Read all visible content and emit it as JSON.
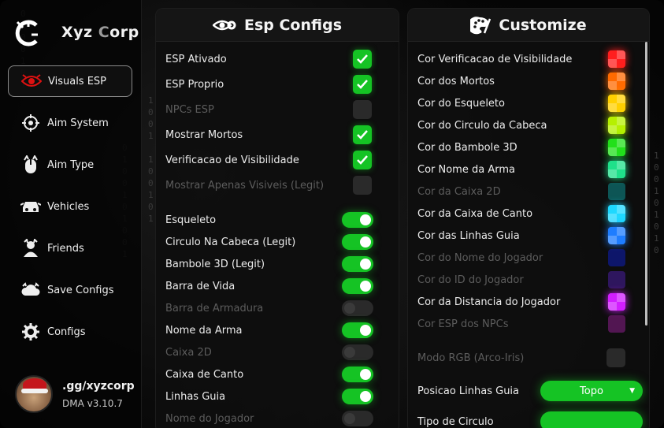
{
  "brand": {
    "name_main": "Xyz",
    "name_accent": "C",
    "name_rest": "orp"
  },
  "nav": [
    {
      "label": "Visuals ESP",
      "icon": "eye-icon",
      "active": true
    },
    {
      "label": "Aim System",
      "icon": "crosshair-icon",
      "active": false
    },
    {
      "label": "Aim Type",
      "icon": "mouse-icon",
      "active": false
    },
    {
      "label": "Vehicles",
      "icon": "car-icon",
      "active": false
    },
    {
      "label": "Friends",
      "icon": "users-icon",
      "active": false
    },
    {
      "label": "Save Configs",
      "icon": "cloud-icon",
      "active": false
    },
    {
      "label": "Configs",
      "icon": "gear-icon",
      "active": false
    }
  ],
  "user": {
    "name": ".gg/xyzcorp",
    "version": "DMA v3.10.7"
  },
  "esp": {
    "title": "Esp Configs",
    "checkboxes": [
      {
        "label": "ESP Ativado",
        "checked": true,
        "enabled": true
      },
      {
        "label": "ESP Proprio",
        "checked": true,
        "enabled": true
      },
      {
        "label": "NPCs ESP",
        "checked": false,
        "enabled": false
      },
      {
        "label": "Mostrar Mortos",
        "checked": true,
        "enabled": true
      },
      {
        "label": "Verificacao de Visibilidade",
        "checked": true,
        "enabled": true
      },
      {
        "label": "Mostrar Apenas Visiveis (Legit)",
        "checked": false,
        "enabled": false
      }
    ],
    "toggles": [
      {
        "label": "Esqueleto",
        "on": true
      },
      {
        "label": "Circulo Na Cabeca (Legit)",
        "on": true
      },
      {
        "label": "Bambole 3D (Legit)",
        "on": true
      },
      {
        "label": "Barra de Vida",
        "on": true
      },
      {
        "label": "Barra de Armadura",
        "on": false
      },
      {
        "label": "Nome da Arma",
        "on": true
      },
      {
        "label": "Caixa 2D",
        "on": false
      },
      {
        "label": "Caixa de Canto",
        "on": true
      },
      {
        "label": "Linhas Guia",
        "on": true
      },
      {
        "label": "Nome do Jogador",
        "on": false
      }
    ]
  },
  "customize": {
    "title": "Customize",
    "colors": [
      {
        "label": "Cor Verificacao de Visibilidade",
        "color": "#ff1e1e",
        "enabled": true
      },
      {
        "label": "Cor dos Mortos",
        "color": "#ff6a00",
        "enabled": true
      },
      {
        "label": "Cor do Esqueleto",
        "color": "#ffd000",
        "enabled": true
      },
      {
        "label": "Cor do Circulo da Cabeca",
        "color": "#b6f000",
        "enabled": true
      },
      {
        "label": "Cor do Bambole 3D",
        "color": "#22e01a",
        "enabled": true
      },
      {
        "label": "Cor Nome da Arma",
        "color": "#1fe08a",
        "enabled": true
      },
      {
        "label": "Cor da Caixa 2D",
        "color": "#0e6e6e",
        "enabled": false
      },
      {
        "label": "Cor da Caixa de Canto",
        "color": "#1ed8ff",
        "enabled": true
      },
      {
        "label": "Cor das Linhas Guia",
        "color": "#1e7dff",
        "enabled": true
      },
      {
        "label": "Cor do Nome do Jogador",
        "color": "#0d1a8a",
        "enabled": false
      },
      {
        "label": "Cor do ID do Jogador",
        "color": "#3a1a7a",
        "enabled": false
      },
      {
        "label": "Cor da Distancia do Jogador",
        "color": "#d21eff",
        "enabled": true
      },
      {
        "label": "Cor ESP dos NPCs",
        "color": "#6a1a6a",
        "enabled": false
      }
    ],
    "rgb_mode": {
      "label": "Modo RGB (Arco-Iris)",
      "enabled": false
    },
    "guide_position": {
      "label": "Posicao Linhas Guia",
      "value": "Topo"
    },
    "circle_type": {
      "label": "Tipo de Circulo"
    }
  }
}
